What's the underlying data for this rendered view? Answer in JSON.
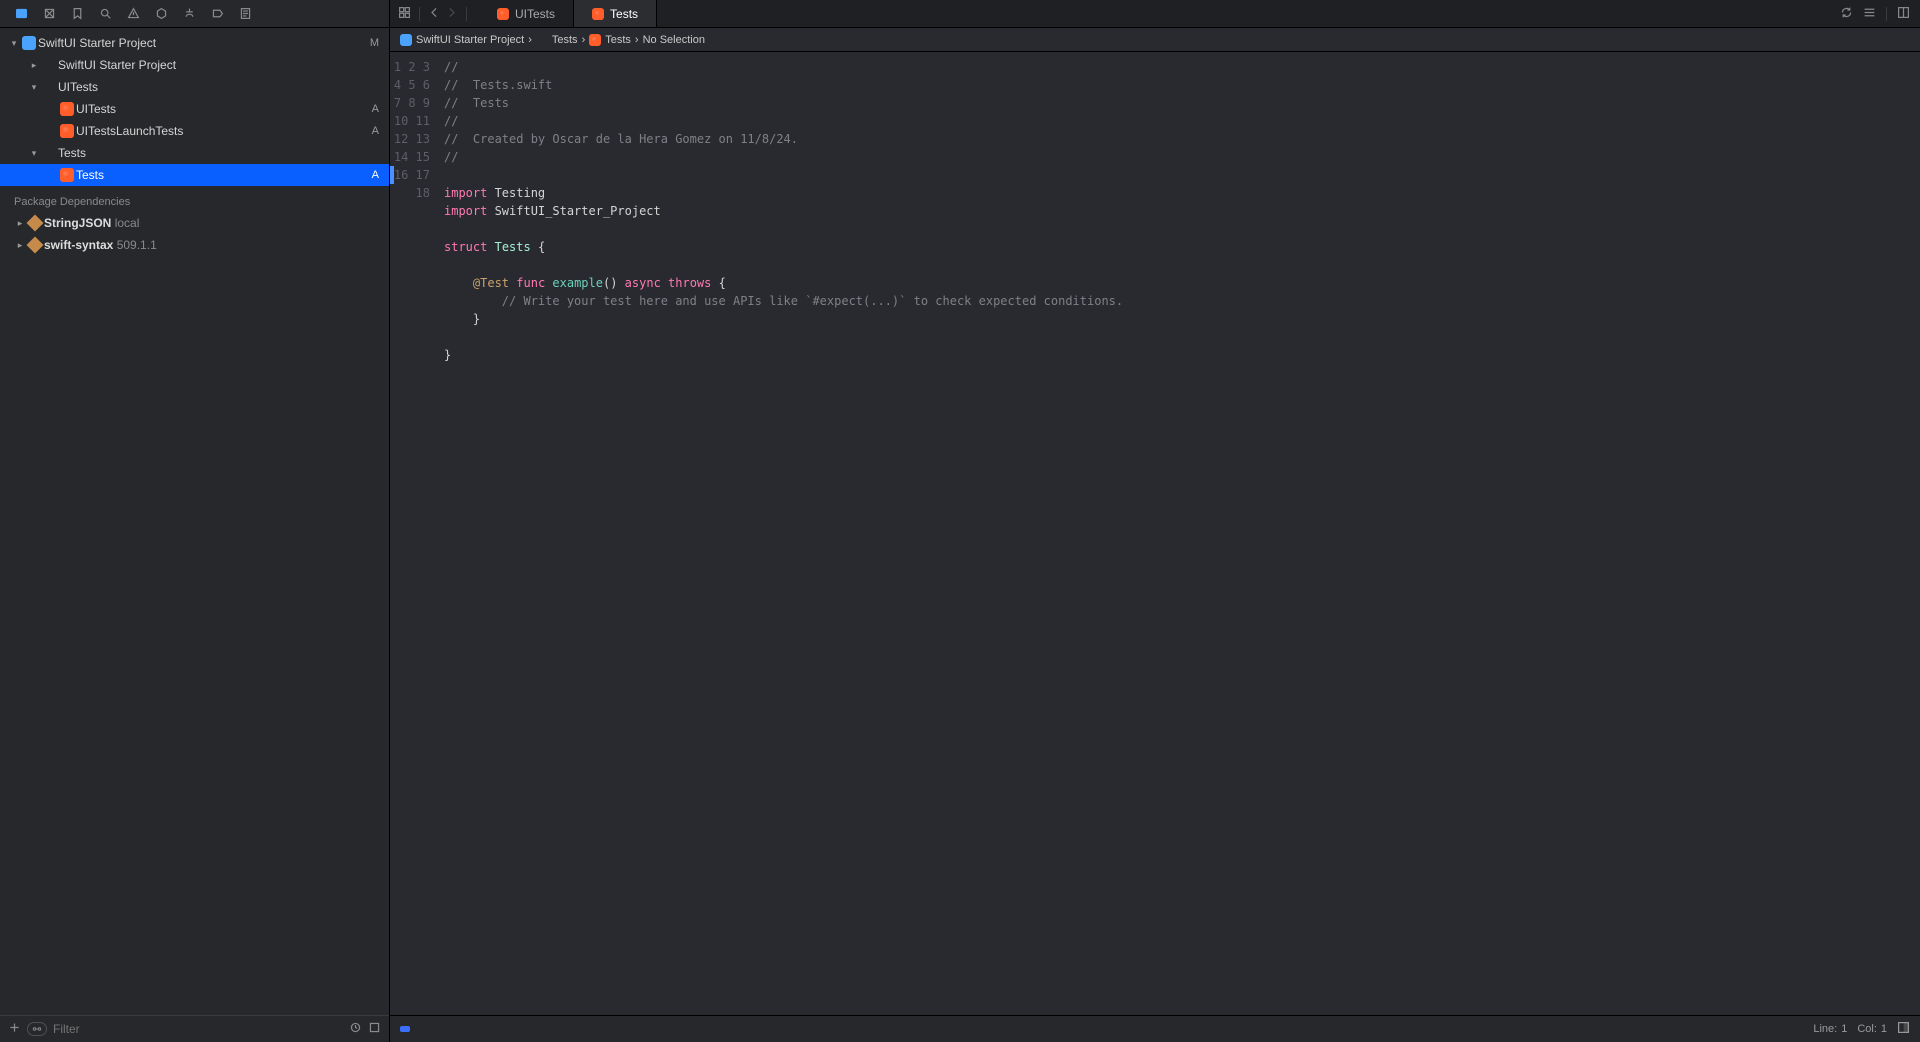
{
  "navigator": {
    "project": {
      "name": "SwiftUI Starter Project",
      "status": "M"
    },
    "tree": [
      {
        "label": "SwiftUI Starter Project",
        "indent": 1,
        "kind": "folder",
        "disclosure": "right",
        "status": ""
      },
      {
        "label": "UITests",
        "indent": 1,
        "kind": "folder",
        "disclosure": "down",
        "status": ""
      },
      {
        "label": "UITests",
        "indent": 2,
        "kind": "swift",
        "disclosure": "",
        "status": "A"
      },
      {
        "label": "UITestsLaunchTests",
        "indent": 2,
        "kind": "swift",
        "disclosure": "",
        "status": "A"
      },
      {
        "label": "Tests",
        "indent": 1,
        "kind": "folder",
        "disclosure": "down",
        "status": ""
      },
      {
        "label": "Tests",
        "indent": 2,
        "kind": "swift",
        "disclosure": "",
        "status": "A",
        "selected": true
      }
    ],
    "dependencies_label": "Package Dependencies",
    "dependencies": [
      {
        "label": "StringJSON",
        "meta": "local"
      },
      {
        "label": "swift-syntax",
        "meta": "509.1.1"
      }
    ],
    "filter_placeholder": "Filter"
  },
  "tabs": [
    {
      "label": "UITests",
      "active": false
    },
    {
      "label": "Tests",
      "active": true
    }
  ],
  "breadcrumbs": [
    {
      "label": "SwiftUI Starter Project",
      "icon": "proj"
    },
    {
      "label": "Tests",
      "icon": "folder"
    },
    {
      "label": "Tests",
      "icon": "swift"
    },
    {
      "label": "No Selection",
      "icon": ""
    }
  ],
  "code": {
    "lines": [
      {
        "n": 1,
        "segs": [
          {
            "t": "//",
            "c": "comment"
          }
        ]
      },
      {
        "n": 2,
        "segs": [
          {
            "t": "//  Tests.swift",
            "c": "comment"
          }
        ]
      },
      {
        "n": 3,
        "segs": [
          {
            "t": "//  Tests",
            "c": "comment"
          }
        ]
      },
      {
        "n": 4,
        "segs": [
          {
            "t": "//",
            "c": "comment"
          }
        ]
      },
      {
        "n": 5,
        "segs": [
          {
            "t": "//  Created by Oscar de la Hera Gomez on 11/8/24.",
            "c": "comment"
          }
        ]
      },
      {
        "n": 6,
        "segs": [
          {
            "t": "//",
            "c": "comment"
          }
        ]
      },
      {
        "n": 7,
        "segs": [
          {
            "t": "",
            "c": ""
          }
        ]
      },
      {
        "n": 8,
        "segs": [
          {
            "t": "import",
            "c": "keyword"
          },
          {
            "t": " Testing",
            "c": ""
          }
        ]
      },
      {
        "n": 9,
        "segs": [
          {
            "t": "import",
            "c": "keyword"
          },
          {
            "t": " SwiftUI_Starter_Project",
            "c": ""
          }
        ]
      },
      {
        "n": 10,
        "segs": [
          {
            "t": "",
            "c": ""
          }
        ]
      },
      {
        "n": 11,
        "segs": [
          {
            "t": "struct",
            "c": "keyword"
          },
          {
            "t": " ",
            "c": ""
          },
          {
            "t": "Tests",
            "c": "type"
          },
          {
            "t": " {",
            "c": ""
          }
        ]
      },
      {
        "n": 12,
        "segs": [
          {
            "t": "",
            "c": ""
          }
        ]
      },
      {
        "n": 13,
        "segs": [
          {
            "t": "    ",
            "c": ""
          },
          {
            "t": "@Test",
            "c": "attr"
          },
          {
            "t": " ",
            "c": ""
          },
          {
            "t": "func",
            "c": "keyword"
          },
          {
            "t": " ",
            "c": ""
          },
          {
            "t": "example",
            "c": "func"
          },
          {
            "t": "()",
            "c": ""
          },
          {
            "t": " ",
            "c": ""
          },
          {
            "t": "async",
            "c": "keyword"
          },
          {
            "t": " ",
            "c": ""
          },
          {
            "t": "throws",
            "c": "keyword"
          },
          {
            "t": " {",
            "c": ""
          }
        ]
      },
      {
        "n": 14,
        "segs": [
          {
            "t": "        // Write your test here and use APIs like `#expect(...)` to check expected conditions.",
            "c": "comment"
          }
        ]
      },
      {
        "n": 15,
        "segs": [
          {
            "t": "    }",
            "c": ""
          }
        ]
      },
      {
        "n": 16,
        "segs": [
          {
            "t": "",
            "c": ""
          }
        ]
      },
      {
        "n": 17,
        "segs": [
          {
            "t": "}",
            "c": ""
          }
        ]
      },
      {
        "n": 18,
        "segs": [
          {
            "t": "",
            "c": ""
          }
        ]
      }
    ]
  },
  "status": {
    "line_label": "Line:",
    "line": "1",
    "col_label": "Col:",
    "col": "1"
  }
}
